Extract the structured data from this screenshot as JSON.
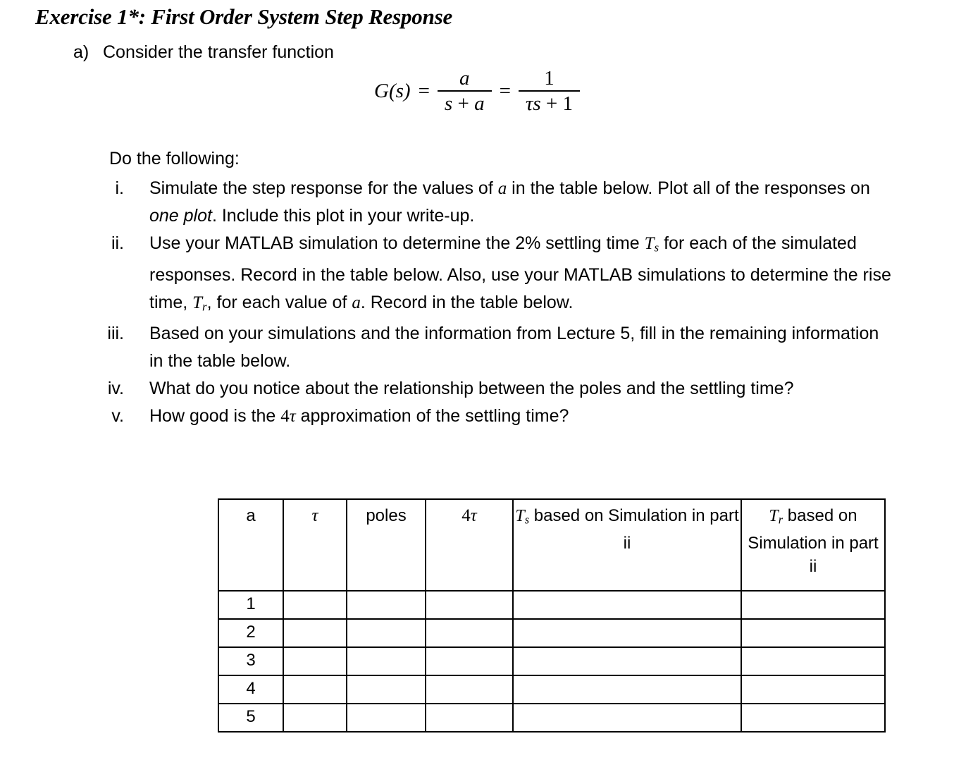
{
  "document": {
    "title": "Exercise 1*: First Order System Step Response",
    "part_a": {
      "marker": "a)",
      "text": "Consider the transfer function"
    },
    "equation": {
      "lhs": "G(s)",
      "equals": "=",
      "frac1_num": "a",
      "frac1_den_s": "s",
      "frac1_den_plus": "+",
      "frac1_den_a": "a",
      "equals2": "=",
      "frac2_num": "1",
      "frac2_den_tau": "τ",
      "frac2_den_s": "s",
      "frac2_den_plus": "+",
      "frac2_den_one": "1",
      "plain": "G(s) = a/(s + a) = 1/(τs + 1)"
    },
    "do_following_label": "Do the following:",
    "items": [
      {
        "numeral": "i.",
        "text_plain": "Simulate the step response for the values of a in the table below. Plot all of the responses on one plot. Include this plot in your write-up.",
        "seg1": "Simulate the step response for the values of ",
        "var1": "a",
        "seg2": " in the table below. Plot all of the responses on ",
        "emph1": "one plot",
        "seg3": ". Include this plot in your write-up."
      },
      {
        "numeral": "ii.",
        "text_plain": "Use your MATLAB simulation to determine the 2% settling time Ts for each of the simulated responses. Record in the table below. Also, use your MATLAB simulations to determine the rise time, Tr, for each value of a. Record in the table below.",
        "seg1": "Use your MATLAB simulation to determine the 2% settling time ",
        "var1_base": "T",
        "var1_sub": "s",
        "seg2": " for each of the simulated responses. Record in the table below. Also, use your MATLAB simulations to determine the rise time, ",
        "var2_base": "T",
        "var2_sub": "r",
        "seg3": ", for each value of ",
        "var3": "a",
        "seg4": ". Record in the table below."
      },
      {
        "numeral": "iii.",
        "text_plain": "Based on your simulations and the information from Lecture 5, fill in the remaining information in the table below.",
        "seg1": "Based on your simulations and the information from Lecture 5, fill in the remaining information in the table below."
      },
      {
        "numeral": "iv.",
        "text_plain": "What do you notice about the relationship between the poles and the settling time?",
        "seg1": "What do you notice about the relationship between the poles and the settling time?"
      },
      {
        "numeral": "v.",
        "text_plain": "How good is the 4τ approximation of the settling time?",
        "seg1": "How good is the ",
        "num1": "4",
        "tau1": "τ",
        "seg2": " approximation of the settling time?"
      }
    ],
    "table": {
      "headers": [
        {
          "key": "a",
          "label": "a"
        },
        {
          "key": "tau",
          "label": "τ"
        },
        {
          "key": "poles",
          "label": "poles"
        },
        {
          "key": "four_tau_num",
          "label": "4",
          "label_tau": "τ",
          "label_full": "4τ"
        },
        {
          "key": "ts",
          "base": "T",
          "sub": "s",
          "rest": " based on Simulation in part ii",
          "label_full": "Ts based on Simulation in part ii"
        },
        {
          "key": "tr",
          "base": "T",
          "sub": "r",
          "rest": " based on Simulation in part ii",
          "label_full": "Tr based on Simulation in part ii"
        }
      ],
      "rows": [
        {
          "a": "1",
          "tau": "",
          "poles": "",
          "four_tau": "",
          "ts": "",
          "tr": ""
        },
        {
          "a": "2",
          "tau": "",
          "poles": "",
          "four_tau": "",
          "ts": "",
          "tr": ""
        },
        {
          "a": "3",
          "tau": "",
          "poles": "",
          "four_tau": "",
          "ts": "",
          "tr": ""
        },
        {
          "a": "4",
          "tau": "",
          "poles": "",
          "four_tau": "",
          "ts": "",
          "tr": ""
        },
        {
          "a": "5",
          "tau": "",
          "poles": "",
          "four_tau": "",
          "ts": "",
          "tr": ""
        }
      ]
    },
    "colors": {
      "text": "#000000",
      "background": "#ffffff",
      "table_border": "#000000"
    }
  }
}
